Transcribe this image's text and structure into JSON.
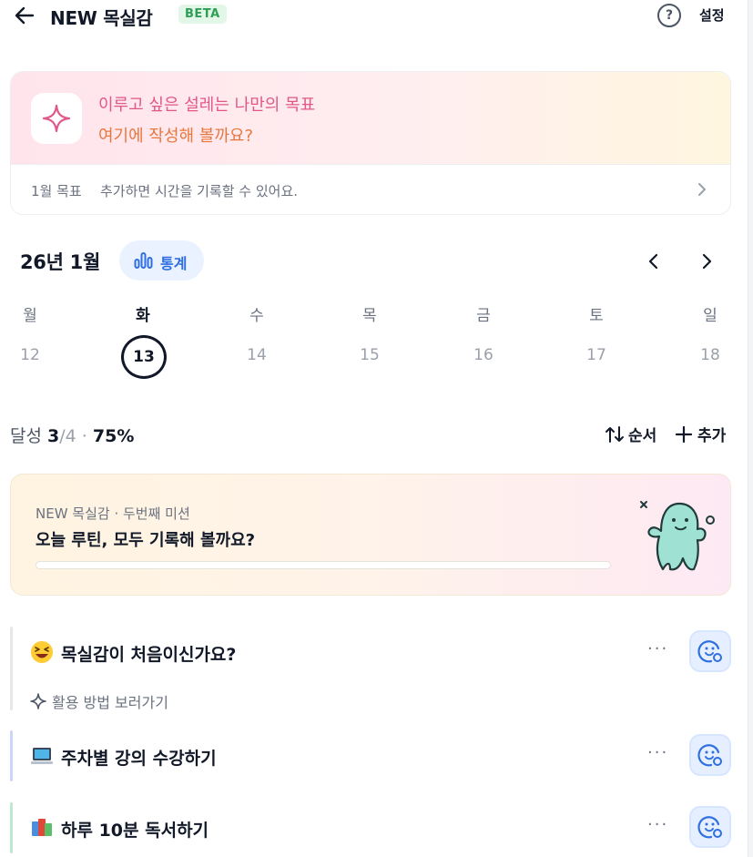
{
  "header": {
    "title": "NEW 목실감",
    "badge": "BETA",
    "help_label": "?",
    "settings_label": "설정"
  },
  "goal_card": {
    "line1": "이루고 싶은 설레는 나만의 목표",
    "line2": "여기에 작성해 볼까요?",
    "month_label": "1월 목표",
    "hint": "추가하면 시간을 기록할 수 있어요.",
    "colors": {
      "line1": "#e0588a",
      "line2": "#e8773e"
    }
  },
  "calendar": {
    "month_title": "26년 1월",
    "stats_label": "통계",
    "weekdays": [
      "월",
      "화",
      "수",
      "목",
      "금",
      "토",
      "일"
    ],
    "days": [
      "12",
      "13",
      "14",
      "15",
      "16",
      "17",
      "18"
    ],
    "today_index": 1
  },
  "summary": {
    "label": "달성",
    "done": "3",
    "total": "/4",
    "separator": "·",
    "percent": "75%",
    "order_label": "순서",
    "add_label": "추가"
  },
  "mission": {
    "subtitle": "NEW 목실감 · 두번째 미션",
    "title": "오늘 루틴, 모두 기록해 볼까요?",
    "progress": 0.0,
    "colors": {
      "fill": "#f4b860"
    }
  },
  "routines": [
    {
      "emoji": "grinning-squint-emoji",
      "title": "목실감이 처음이신가요?",
      "stripe_color": "#e5e7eb",
      "more_label": "···",
      "howto_label": "활용 방법 보러가기"
    },
    {
      "emoji": "laptop-emoji",
      "title": "주차별 강의 수강하기",
      "stripe_color": "#c9d6f5",
      "more_label": "···"
    },
    {
      "emoji": "books-emoji",
      "title": "하루 10분 독서하기",
      "stripe_color": "#bfe8cf",
      "more_label": "···"
    }
  ]
}
